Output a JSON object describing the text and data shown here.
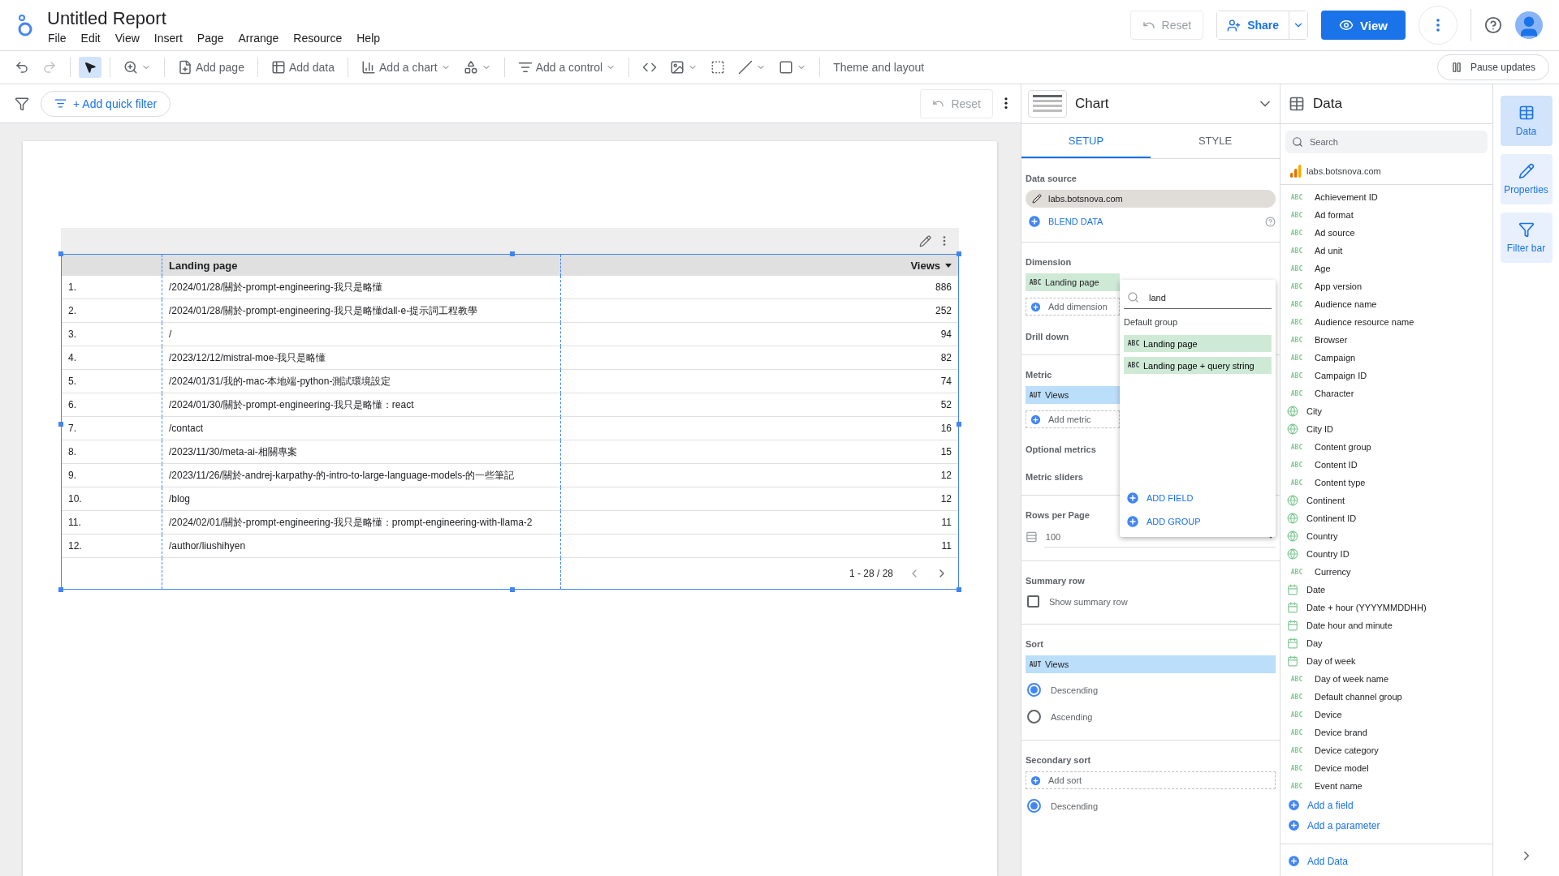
{
  "header": {
    "title": "Untitled Report",
    "menu": [
      "File",
      "Edit",
      "View",
      "Insert",
      "Page",
      "Arrange",
      "Resource",
      "Help"
    ],
    "reset": "Reset",
    "share": "Share",
    "view": "View"
  },
  "toolbar": {
    "select_selected": true,
    "add_page": "Add page",
    "add_data": "Add data",
    "add_chart": "Add a chart",
    "add_control": "Add a control",
    "theme": "Theme and layout",
    "pause": "Pause updates"
  },
  "filter_bar": {
    "add_filter": "+ Add quick filter",
    "reset": "Reset"
  },
  "table": {
    "columns": [
      "Landing page",
      "Views"
    ],
    "rows": [
      {
        "index": "1.",
        "page": "/2024/01/28/關於-prompt-engineering-我只是略懂",
        "views": "886"
      },
      {
        "index": "2.",
        "page": "/2024/01/28/關於-prompt-engineering-我只是略懂dall-e-提示詞工程教學",
        "views": "252"
      },
      {
        "index": "3.",
        "page": "/",
        "views": "94"
      },
      {
        "index": "4.",
        "page": "/2023/12/12/mistral-moe-我只是略懂",
        "views": "82"
      },
      {
        "index": "5.",
        "page": "/2024/01/31/我的-mac-本地端-python-測試環境設定",
        "views": "74"
      },
      {
        "index": "6.",
        "page": "/2024/01/30/關於-prompt-engineering-我只是略懂：react",
        "views": "52"
      },
      {
        "index": "7.",
        "page": "/contact",
        "views": "16"
      },
      {
        "index": "8.",
        "page": "/2023/11/30/meta-ai-相關專案",
        "views": "15"
      },
      {
        "index": "9.",
        "page": "/2023/11/26/關於-andrej-karpathy-的-intro-to-large-language-models-的一些筆記",
        "views": "12"
      },
      {
        "index": "10.",
        "page": "/blog",
        "views": "12"
      },
      {
        "index": "11.",
        "page": "/2024/02/01/關於-prompt-engineering-我只是略懂：prompt-engineering-with-llama-2",
        "views": "11"
      },
      {
        "index": "12.",
        "page": "/author/liushihyen",
        "views": "11"
      }
    ],
    "pagination": "1 - 28 / 28"
  },
  "chart_panel": {
    "title": "Chart",
    "tabs": [
      {
        "label": "SETUP",
        "selected": true
      },
      {
        "label": "STYLE",
        "selected": false
      }
    ],
    "data_source": {
      "label": "Data source",
      "value": "labs.botsnova.com",
      "blend": "BLEND DATA"
    },
    "dimension": {
      "label": "Dimension",
      "field": {
        "badge": "ABC",
        "name": "Landing page"
      },
      "add": "Add dimension"
    },
    "drill_down": "Drill down",
    "metric": {
      "label": "Metric",
      "field": {
        "badge": "AUT",
        "name": "Views"
      },
      "add": "Add metric"
    },
    "optional_metrics": "Optional metrics",
    "metric_sliders": "Metric sliders",
    "rows_per_page": {
      "label": "Rows per Page",
      "value": "100"
    },
    "summary_row": {
      "label": "Summary row",
      "checkbox": "Show summary row",
      "checked": false
    },
    "sort": {
      "label": "Sort",
      "field": {
        "badge": "AUT",
        "name": "Views"
      },
      "options": [
        {
          "label": "Descending",
          "selected": true
        },
        {
          "label": "Ascending",
          "selected": false
        }
      ]
    },
    "secondary_sort": {
      "label": "Secondary sort",
      "add": "Add sort",
      "options": [
        {
          "label": "Descending",
          "selected": true
        }
      ]
    }
  },
  "field_picker": {
    "search": "land",
    "group": "Default group",
    "items": [
      {
        "badge": "ABC",
        "name": "Landing page"
      },
      {
        "badge": "ABC",
        "name": "Landing page + query string"
      }
    ],
    "actions": [
      "ADD FIELD",
      "ADD GROUP"
    ]
  },
  "data_panel": {
    "title": "Data",
    "search_placeholder": "Search",
    "source": "labs.botsnova.com",
    "fields": [
      {
        "name": "Achievement ID",
        "kind": "text",
        "badge": "ABC"
      },
      {
        "name": "Ad format",
        "kind": "text",
        "badge": "ABC"
      },
      {
        "name": "Ad source",
        "kind": "text",
        "badge": "ABC"
      },
      {
        "name": "Ad unit",
        "kind": "text",
        "badge": "ABC"
      },
      {
        "name": "Age",
        "kind": "text",
        "badge": "ABC"
      },
      {
        "name": "App version",
        "kind": "text",
        "badge": "ABC"
      },
      {
        "name": "Audience name",
        "kind": "text",
        "badge": "ABC"
      },
      {
        "name": "Audience resource name",
        "kind": "text",
        "badge": "ABC"
      },
      {
        "name": "Browser",
        "kind": "text",
        "badge": "ABC"
      },
      {
        "name": "Campaign",
        "kind": "text",
        "badge": "ABC"
      },
      {
        "name": "Campaign ID",
        "kind": "text",
        "badge": "ABC"
      },
      {
        "name": "Character",
        "kind": "text",
        "badge": "ABC"
      },
      {
        "name": "City",
        "kind": "geo"
      },
      {
        "name": "City ID",
        "kind": "geo"
      },
      {
        "name": "Content group",
        "kind": "text",
        "badge": "ABC"
      },
      {
        "name": "Content ID",
        "kind": "text",
        "badge": "ABC"
      },
      {
        "name": "Content type",
        "kind": "text",
        "badge": "ABC"
      },
      {
        "name": "Continent",
        "kind": "geo"
      },
      {
        "name": "Continent ID",
        "kind": "geo"
      },
      {
        "name": "Country",
        "kind": "geo"
      },
      {
        "name": "Country ID",
        "kind": "geo"
      },
      {
        "name": "Currency",
        "kind": "text",
        "badge": "ABC"
      },
      {
        "name": "Date",
        "kind": "date"
      },
      {
        "name": "Date + hour (YYYYMMDDHH)",
        "kind": "date"
      },
      {
        "name": "Date hour and minute",
        "kind": "date"
      },
      {
        "name": "Day",
        "kind": "date"
      },
      {
        "name": "Day of week",
        "kind": "date"
      },
      {
        "name": "Day of week name",
        "kind": "text",
        "badge": "ABC"
      },
      {
        "name": "Default channel group",
        "kind": "text",
        "badge": "ABC"
      },
      {
        "name": "Device",
        "kind": "text",
        "badge": "ABC"
      },
      {
        "name": "Device brand",
        "kind": "text",
        "badge": "ABC"
      },
      {
        "name": "Device category",
        "kind": "text",
        "badge": "ABC"
      },
      {
        "name": "Device model",
        "kind": "text",
        "badge": "ABC"
      },
      {
        "name": "Event name",
        "kind": "text",
        "badge": "ABC"
      }
    ],
    "links": [
      "Add a field",
      "Add a parameter"
    ],
    "add_data": "Add Data"
  },
  "rail": [
    {
      "label": "Data",
      "selected": true
    },
    {
      "label": "Properties",
      "selected": false
    },
    {
      "label": "Filter bar",
      "selected": false
    }
  ]
}
